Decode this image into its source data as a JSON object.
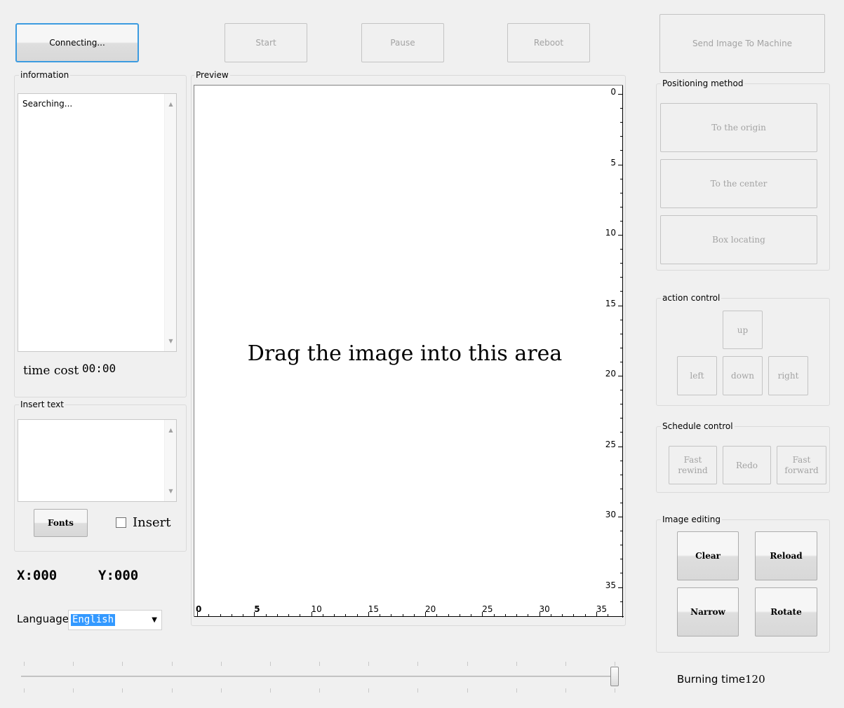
{
  "top_buttons": {
    "connecting": "Connecting...",
    "start": "Start",
    "pause": "Pause",
    "reboot": "Reboot",
    "send_image": "Send Image To Machine"
  },
  "information": {
    "title": "information",
    "log_text": "Searching...",
    "time_cost_label": "time cost",
    "time_cost_value": "00:00"
  },
  "insert_text": {
    "title": "Insert text",
    "value": "",
    "fonts_button": "Fonts",
    "insert_checkbox_label": "Insert",
    "insert_checked": false
  },
  "coords": {
    "x": "X:000",
    "y": "Y:000"
  },
  "language": {
    "label": "Language",
    "selected": "English"
  },
  "preview": {
    "title": "Preview",
    "drop_hint": "Drag the image into this area",
    "x_axis_labels": [
      "0",
      "5",
      "10",
      "15",
      "20",
      "25",
      "30",
      "35"
    ],
    "y_axis_labels": [
      "0",
      "5",
      "10",
      "15",
      "20",
      "25",
      "30",
      "35"
    ]
  },
  "positioning": {
    "title": "Positioning method",
    "to_origin": "To the origin",
    "to_center": "To the center",
    "box_locating": "Box locating"
  },
  "action_control": {
    "title": "action control",
    "up": "up",
    "left": "left",
    "down": "down",
    "right": "right"
  },
  "schedule_control": {
    "title": "Schedule control",
    "fast_rewind": "Fast rewind",
    "redo": "Redo",
    "fast_forward": "Fast forward"
  },
  "image_editing": {
    "title": "Image editing",
    "clear": "Clear",
    "reload": "Reload",
    "narrow": "Narrow",
    "rotate": "Rotate"
  },
  "burning": {
    "label": "Burning time",
    "value": "120"
  },
  "slider": {
    "value_fraction": 1.0
  },
  "colors": {
    "focus_border": "#3c9be0",
    "selection_bg": "#3399ff"
  }
}
